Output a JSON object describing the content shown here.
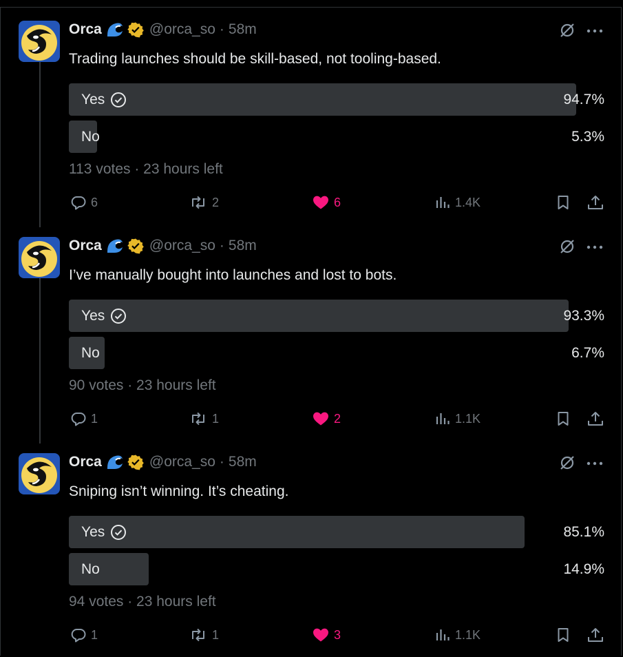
{
  "tweets": [
    {
      "author": {
        "name": "Orca",
        "handle": "@orca_so",
        "separator": "·",
        "time": "58m"
      },
      "text": "Trading launches should be skill-based, not tooling-based.",
      "poll": {
        "options": [
          {
            "label": "Yes",
            "percent_text": "94.7%",
            "share": 0.947,
            "winner": true
          },
          {
            "label": "No",
            "percent_text": "5.3%",
            "share": 0.053,
            "winner": false
          }
        ],
        "meta": "113 votes · 23 hours left"
      },
      "actions": {
        "replies": "6",
        "reposts": "2",
        "likes": "6",
        "views": "1.4K"
      }
    },
    {
      "author": {
        "name": "Orca",
        "handle": "@orca_so",
        "separator": "·",
        "time": "58m"
      },
      "text": "I’ve manually bought into launches and lost to bots.",
      "poll": {
        "options": [
          {
            "label": "Yes",
            "percent_text": "93.3%",
            "share": 0.933,
            "winner": true
          },
          {
            "label": "No",
            "percent_text": "6.7%",
            "share": 0.067,
            "winner": false
          }
        ],
        "meta": "90 votes · 23 hours left"
      },
      "actions": {
        "replies": "1",
        "reposts": "1",
        "likes": "2",
        "views": "1.1K"
      }
    },
    {
      "author": {
        "name": "Orca",
        "handle": "@orca_so",
        "separator": "·",
        "time": "58m"
      },
      "text": "Sniping isn’t winning. It’s cheating.",
      "poll": {
        "options": [
          {
            "label": "Yes",
            "percent_text": "85.1%",
            "share": 0.851,
            "winner": true
          },
          {
            "label": "No",
            "percent_text": "14.9%",
            "share": 0.149,
            "winner": false
          }
        ],
        "meta": "94 votes · 23 hours left"
      },
      "actions": {
        "replies": "1",
        "reposts": "1",
        "likes": "3",
        "views": "1.1K"
      }
    }
  ],
  "icons": [
    "orca-avatar-icon",
    "wave-emoji-icon",
    "verified-badge-icon",
    "grok-icon",
    "more-icon",
    "check-circle-icon",
    "reply-icon",
    "repost-icon",
    "like-icon",
    "views-icon",
    "bookmark-icon",
    "share-icon"
  ],
  "colors": {
    "background": "#000000",
    "text": "#e7e9ea",
    "muted": "#71767b",
    "poll_bar": "#333639",
    "like": "#f91880",
    "verified": "#e8b829",
    "wave": "#1d9bf0"
  }
}
